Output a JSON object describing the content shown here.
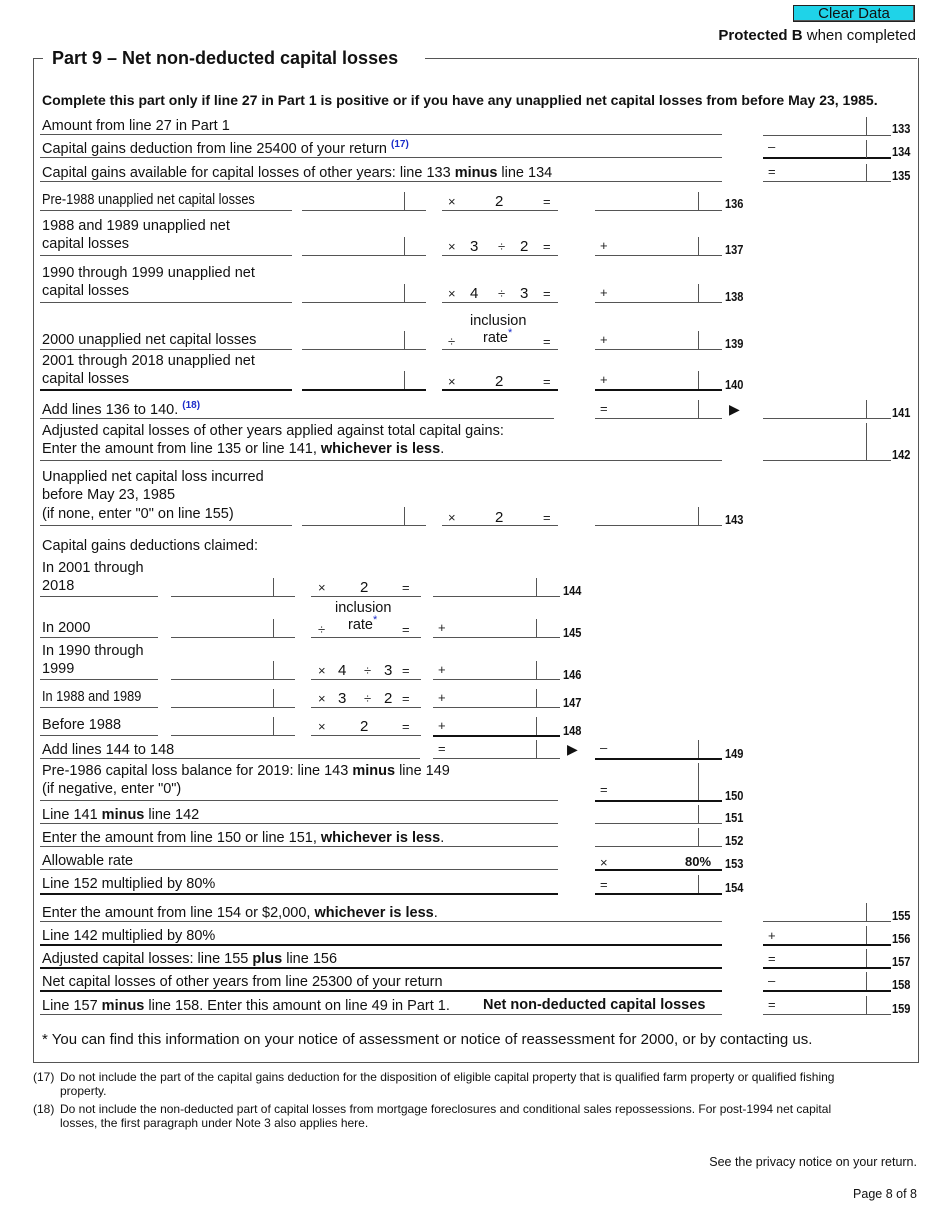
{
  "header": {
    "clear_button": "Clear Data",
    "protected_bold": "Protected B",
    "protected_rest": " when completed"
  },
  "part": {
    "title": "Part 9 –  Net non-deducted capital losses",
    "instruction": "Complete this part only if line 27 in Part 1 is positive or if you have any unapplied net capital losses from before May 23, 1985."
  },
  "lines": {
    "l133": {
      "label": "Amount from line 27 in Part 1",
      "num": "133",
      "op": ""
    },
    "l134": {
      "label": "Capital gains deduction from line 25400 of your return",
      "ref": "(17)",
      "num": "134",
      "op": "–"
    },
    "l135": {
      "label_a": "Capital gains available for capital losses of other years: line 133 ",
      "label_bold": "minus",
      "label_b": " line 134",
      "num": "135",
      "op": "="
    },
    "l136": {
      "label": "Pre-1988 unapplied net capital losses",
      "calc": [
        "×",
        "2",
        "="
      ],
      "num": "136",
      "op": ""
    },
    "l137": {
      "label1": "1988 and 1989 unapplied net",
      "label2": "capital losses",
      "calc": [
        "×",
        "3",
        "÷",
        "2",
        "="
      ],
      "num": "137",
      "op": "+"
    },
    "l138": {
      "label1": "1990 through 1999 unapplied net",
      "label2": "capital losses",
      "calc": [
        "×",
        "4",
        "÷",
        "3",
        "="
      ],
      "num": "138",
      "op": "+"
    },
    "l139": {
      "label": "2000 unapplied net capital losses",
      "calc": [
        "÷",
        "inclusion",
        "rate",
        "*",
        "="
      ],
      "num": "139",
      "op": "+"
    },
    "l140": {
      "label1": "2001 through 2018 unapplied net",
      "label2": "capital losses",
      "calc": [
        "×",
        "2",
        "="
      ],
      "num": "140",
      "op": "+"
    },
    "l141": {
      "label": "Add lines 136 to 140.",
      "ref": "(18)",
      "op": "=",
      "num": "141"
    },
    "l142": {
      "label1": "Adjusted capital losses of other years applied against total capital gains:",
      "label2a": "Enter the amount from line 135 or line 141, ",
      "label2b": "whichever is less",
      "label2c": ".",
      "num": "142"
    },
    "l143": {
      "label1": "Unapplied net capital loss incurred",
      "label2": "before May 23, 1985",
      "label3": "(if none, enter \"0\" on line 155)",
      "calc": [
        "×",
        "2",
        "="
      ],
      "num": "143"
    },
    "cg_heading": "Capital gains deductions claimed:",
    "l144": {
      "label1": "In 2001 through",
      "label2": "2018",
      "calc": [
        "×",
        "2",
        "="
      ],
      "num": "144",
      "op": ""
    },
    "l145": {
      "label": "In 2000",
      "calc": [
        "÷",
        "inclusion",
        "rate",
        "*",
        "="
      ],
      "num": "145",
      "op": "+"
    },
    "l146": {
      "label1": "In 1990 through",
      "label2": "1999",
      "calc": [
        "×",
        "4",
        "÷",
        "3",
        "="
      ],
      "num": "146",
      "op": "+"
    },
    "l147": {
      "label": "In 1988 and 1989",
      "calc": [
        "×",
        "3",
        "÷",
        "2",
        "="
      ],
      "num": "147",
      "op": "+"
    },
    "l148": {
      "label": "Before 1988",
      "calc": [
        "×",
        "2",
        "="
      ],
      "num": "148",
      "op": "+"
    },
    "l149": {
      "label": "Add lines 144 to 148",
      "op_mid": "=",
      "op": "–",
      "num": "149"
    },
    "l150": {
      "label1a": "Pre-1986 capital loss balance for 2019: line 143 ",
      "label1b": "minus",
      "label1c": " line 149",
      "label2": "(if negative, enter \"0\")",
      "op": "=",
      "num": "150"
    },
    "l151": {
      "label_a": "Line 141 ",
      "label_b": "minus",
      "label_c": " line 142",
      "num": "151"
    },
    "l152": {
      "label_a": "Enter the amount from line 150 or line 151, ",
      "label_b": "whichever is less",
      "label_c": ".",
      "num": "152"
    },
    "l153": {
      "label": "Allowable rate",
      "op": "×",
      "value": "80%",
      "num": "153"
    },
    "l154": {
      "label": "Line 152 multiplied by 80%",
      "op": "=",
      "num": "154"
    },
    "l155": {
      "label_a": "Enter the amount from line 154 or $2,000, ",
      "label_b": "whichever is less",
      "label_c": ".",
      "num": "155",
      "op": ""
    },
    "l156": {
      "label": "Line 142 multiplied by 80%",
      "op": "+",
      "num": "156"
    },
    "l157": {
      "label_a": "Adjusted capital losses: line 155 ",
      "label_b": "plus",
      "label_c": " line 156",
      "op": "=",
      "num": "157"
    },
    "l158": {
      "label": "Net capital losses of other years from line 25300 of your return",
      "op": "–",
      "num": "158"
    },
    "l159": {
      "label_a": "Line 157 ",
      "label_b": "minus",
      "label_c": " line 158. Enter this amount on line 49 in Part 1.",
      "label_bold2": "Net non-deducted capital losses",
      "op": "=",
      "num": "159"
    }
  },
  "asterisk_note": "* You can find this information on your notice of assessment or notice of reassessment for 2000, or by contacting us.",
  "footnotes": [
    {
      "num": "(17)",
      "line1": "Do not include the part of the capital gains deduction for the disposition of eligible capital property that is qualified farm property or qualified fishing",
      "line2": "property."
    },
    {
      "num": "(18)",
      "line1": "Do not include the non-deducted part of capital losses from mortgage foreclosures and conditional sales repossessions. For post-1994 net capital",
      "line2": "losses, the first paragraph under Note 3 also applies here."
    }
  ],
  "footer": {
    "privacy": "See the privacy notice on your return.",
    "page": "Page 8 of 8"
  }
}
